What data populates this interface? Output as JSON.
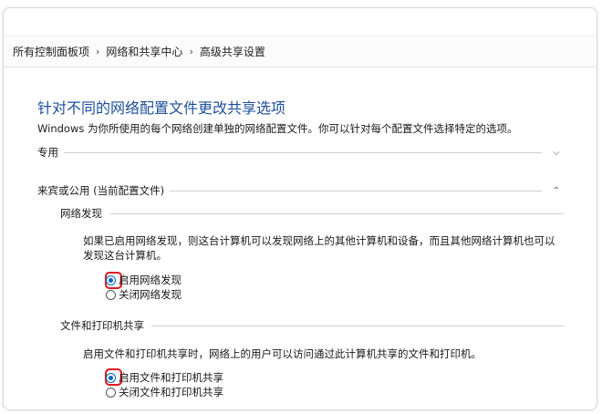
{
  "breadcrumb": {
    "items": [
      "所有控制面板项",
      "网络和共享中心",
      "高级共享设置"
    ],
    "separator": "›"
  },
  "page": {
    "title": "针对不同的网络配置文件更改共享选项",
    "description": "Windows 为你所使用的每个网络创建单独的网络配置文件。你可以针对每个配置文件选择特定的选项。"
  },
  "profiles": [
    {
      "label": "专用",
      "expanded": false,
      "chevron": "chevron-down-icon"
    },
    {
      "label": "来宾或公用 (当前配置文件)",
      "expanded": true,
      "chevron": "chevron-up-icon"
    }
  ],
  "network_discovery": {
    "heading": "网络发现",
    "description": "如果已启用网络发现，则这台计算机可以发现网络上的其他计算机和设备，而且其他网络计算机也可以发现这台计算机。",
    "options": [
      {
        "label": "启用网络发现",
        "checked": true
      },
      {
        "label": "关闭网络发现",
        "checked": false
      }
    ]
  },
  "file_printer_sharing": {
    "heading": "文件和打印机共享",
    "description": "启用文件和打印机共享时，网络上的用户可以访问通过此计算机共享的文件和打印机。",
    "options": [
      {
        "label": "启用文件和打印机共享",
        "checked": true
      },
      {
        "label": "关闭文件和打印机共享",
        "checked": false
      }
    ]
  },
  "colors": {
    "title": "#1c4f9c",
    "radio_selected": "#0067c0",
    "highlight_box": "#e0171e"
  }
}
